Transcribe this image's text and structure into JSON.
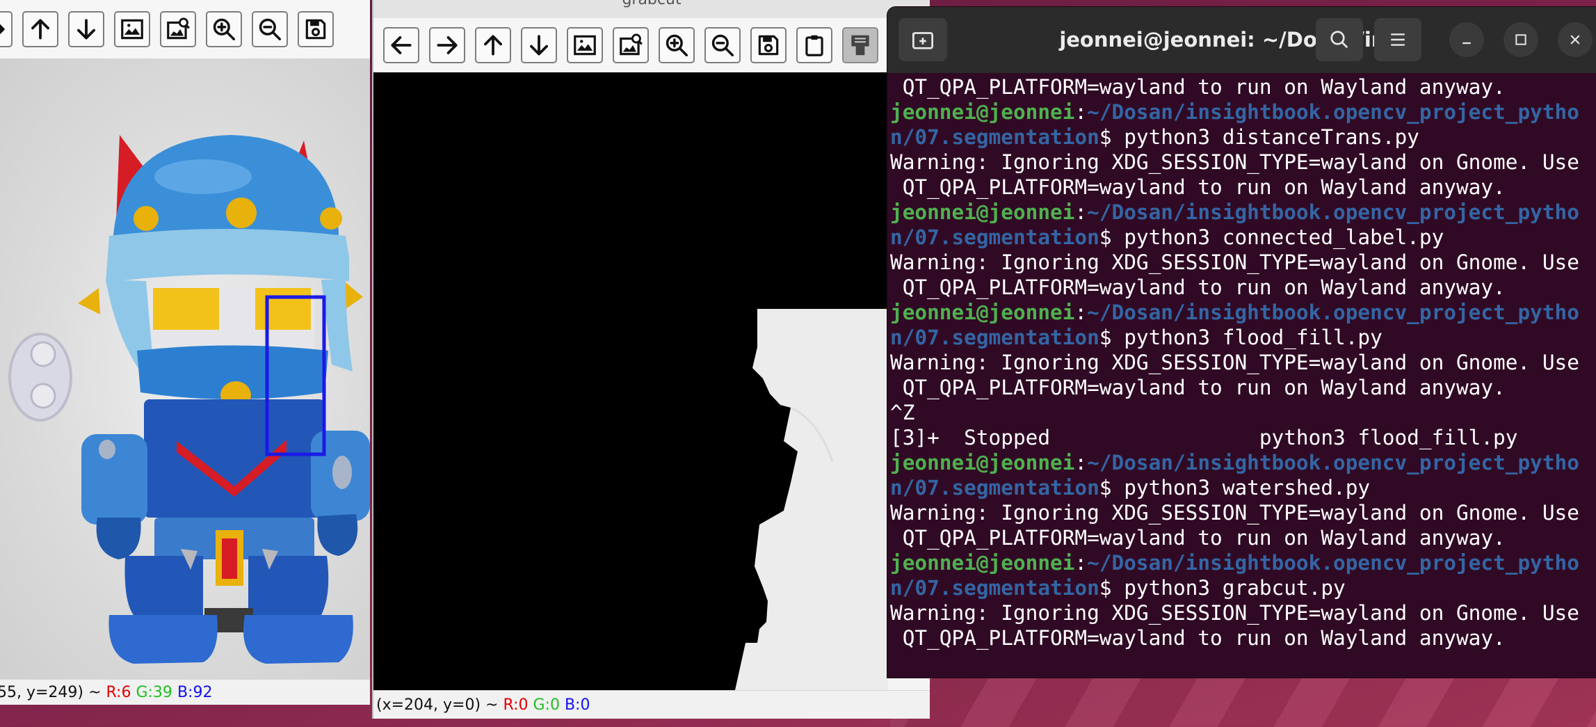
{
  "robot_window": {
    "toolbar_icons": [
      "arrow-right-icon",
      "arrow-up-icon",
      "arrow-down-icon",
      "image-icon",
      "image-zoom-icon",
      "zoom-in-icon",
      "zoom-out-icon",
      "save-icon"
    ],
    "status": {
      "coords": "55, y=249) ~ ",
      "r": "R:6",
      "g": "G:39",
      "b": "B:92"
    },
    "roi_rect_color": "#1a1ae6"
  },
  "grabcut_window": {
    "title": "grabcut",
    "toolbar_icons": [
      "arrow-left-icon",
      "arrow-right-icon",
      "arrow-up-icon",
      "arrow-down-icon",
      "image-icon",
      "image-zoom-icon",
      "zoom-in-icon",
      "zoom-out-icon",
      "save-icon",
      "clipboard-icon",
      "properties-icon"
    ],
    "status": {
      "coords": "(x=204, y=0) ~ ",
      "r": "R:0",
      "g": "G:0",
      "b": "B:0"
    }
  },
  "terminal": {
    "title": "jeonnei@jeonnei: ~/Dosan/ins…",
    "background": "#300a24",
    "user_color": "#4fb14f",
    "path_color": "#3465a4",
    "lines": [
      {
        "t": "out",
        "text": " QT_QPA_PLATFORM=wayland to run on Wayland anyway."
      },
      {
        "t": "prompt",
        "user": "jeonnei@jeonnei",
        "path": "~/Dosan/insightbook.opencv_project_pytho"
      },
      {
        "t": "prompt2",
        "path": "n/07.segmentation",
        "cmd": "$ python3 distanceTrans.py"
      },
      {
        "t": "out",
        "text": "Warning: Ignoring XDG_SESSION_TYPE=wayland on Gnome. Use"
      },
      {
        "t": "out",
        "text": " QT_QPA_PLATFORM=wayland to run on Wayland anyway."
      },
      {
        "t": "prompt",
        "user": "jeonnei@jeonnei",
        "path": "~/Dosan/insightbook.opencv_project_pytho"
      },
      {
        "t": "prompt2",
        "path": "n/07.segmentation",
        "cmd": "$ python3 connected_label.py"
      },
      {
        "t": "out",
        "text": "Warning: Ignoring XDG_SESSION_TYPE=wayland on Gnome. Use"
      },
      {
        "t": "out",
        "text": " QT_QPA_PLATFORM=wayland to run on Wayland anyway."
      },
      {
        "t": "prompt",
        "user": "jeonnei@jeonnei",
        "path": "~/Dosan/insightbook.opencv_project_pytho"
      },
      {
        "t": "prompt2",
        "path": "n/07.segmentation",
        "cmd": "$ python3 flood_fill.py"
      },
      {
        "t": "out",
        "text": "Warning: Ignoring XDG_SESSION_TYPE=wayland on Gnome. Use"
      },
      {
        "t": "out",
        "text": " QT_QPA_PLATFORM=wayland to run on Wayland anyway."
      },
      {
        "t": "out",
        "text": "^Z"
      },
      {
        "t": "out",
        "text": "[3]+  Stopped                 python3 flood_fill.py"
      },
      {
        "t": "prompt",
        "user": "jeonnei@jeonnei",
        "path": "~/Dosan/insightbook.opencv_project_pytho"
      },
      {
        "t": "prompt2",
        "path": "n/07.segmentation",
        "cmd": "$ python3 watershed.py"
      },
      {
        "t": "out",
        "text": "Warning: Ignoring XDG_SESSION_TYPE=wayland on Gnome. Use"
      },
      {
        "t": "out",
        "text": " QT_QPA_PLATFORM=wayland to run on Wayland anyway."
      },
      {
        "t": "prompt",
        "user": "jeonnei@jeonnei",
        "path": "~/Dosan/insightbook.opencv_project_pytho"
      },
      {
        "t": "prompt2",
        "path": "n/07.segmentation",
        "cmd": "$ python3 grabcut.py"
      },
      {
        "t": "out",
        "text": "Warning: Ignoring XDG_SESSION_TYPE=wayland on Gnome. Use"
      },
      {
        "t": "out",
        "text": " QT_QPA_PLATFORM=wayland to run on Wayland anyway."
      }
    ]
  }
}
